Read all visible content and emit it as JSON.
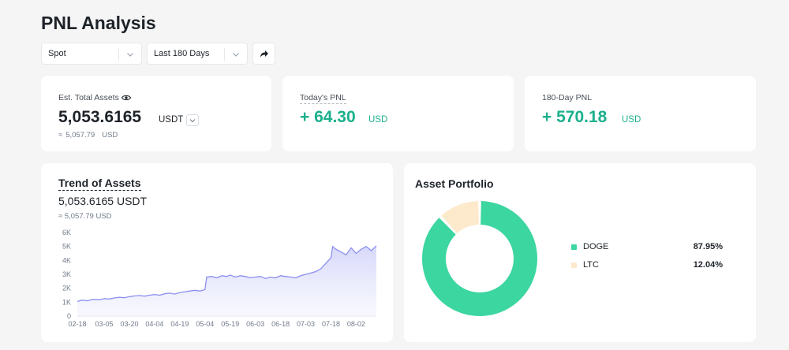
{
  "page_title": "PNL Analysis",
  "filters": {
    "account_type": "Spot",
    "time_range": "Last 180 Days"
  },
  "summary": {
    "total_assets": {
      "label": "Est. Total Assets",
      "value": "5,053.6165",
      "unit": "USDT",
      "approx_symbol": "≈",
      "approx_value": "5,057.79",
      "approx_unit": "USD"
    },
    "today_pnl": {
      "label": "Today's PNL",
      "value": "+ 64.30",
      "unit": "USD"
    },
    "pnl_180": {
      "label": "180-Day PNL",
      "value": "+ 570.18",
      "unit": "USD"
    }
  },
  "trend": {
    "title": "Trend of Assets",
    "value": "5,053.6165 USDT",
    "approx": "≈ 5,057.79 USD"
  },
  "portfolio": {
    "title": "Asset Portfolio",
    "items": [
      {
        "name": "DOGE",
        "percent": "87.95%",
        "value": 87.95,
        "color": "#3cd6a0"
      },
      {
        "name": "LTC",
        "percent": "12.04%",
        "value": 12.04,
        "color": "#fde9cc"
      }
    ]
  },
  "colors": {
    "accent_green": "#1bb08c",
    "chart_line": "#8c8ff0",
    "chart_fill": "#e4e6fb"
  },
  "chart_data": {
    "type": "area",
    "title": "Trend of Assets",
    "xlabel": "",
    "ylabel": "",
    "ylim": [
      0,
      6000
    ],
    "y_ticks": [
      "0",
      "1K",
      "2K",
      "3K",
      "4K",
      "5K",
      "6K"
    ],
    "y_tick_values": [
      0,
      1000,
      2000,
      3000,
      4000,
      5000,
      6000
    ],
    "x_ticks": [
      "02-18",
      "03-05",
      "03-20",
      "04-04",
      "04-19",
      "05-04",
      "05-19",
      "06-03",
      "06-18",
      "07-03",
      "07-18",
      "08-02"
    ],
    "grid": false,
    "series": [
      {
        "x": [
          "02-18",
          "02-21",
          "02-24",
          "02-27",
          "03-02",
          "03-05",
          "03-08",
          "03-11",
          "03-14",
          "03-17",
          "03-20",
          "03-23",
          "03-26",
          "03-29",
          "04-01",
          "04-04",
          "04-07",
          "04-10",
          "04-13",
          "04-16",
          "04-19",
          "04-22",
          "04-25",
          "04-28",
          "05-01",
          "05-04",
          "05-05",
          "05-08",
          "05-11",
          "05-14",
          "05-17",
          "05-19",
          "05-22",
          "05-25",
          "05-28",
          "05-31",
          "06-03",
          "06-06",
          "06-09",
          "06-12",
          "06-15",
          "06-18",
          "06-21",
          "06-24",
          "06-27",
          "06-30",
          "07-03",
          "07-06",
          "07-09",
          "07-12",
          "07-15",
          "07-18",
          "07-19",
          "07-21",
          "07-24",
          "07-27",
          "07-30",
          "08-02",
          "08-05",
          "08-08",
          "08-11",
          "08-14"
        ],
        "values": [
          1050,
          1150,
          1100,
          1200,
          1180,
          1250,
          1230,
          1300,
          1350,
          1320,
          1400,
          1450,
          1480,
          1430,
          1500,
          1550,
          1500,
          1600,
          1650,
          1580,
          1700,
          1750,
          1800,
          1850,
          1800,
          1900,
          2800,
          2850,
          2750,
          2900,
          2850,
          2950,
          2800,
          2900,
          2850,
          2750,
          2800,
          2850,
          2700,
          2800,
          2750,
          2900,
          2850,
          2800,
          2750,
          2900,
          3000,
          3100,
          3200,
          3400,
          3800,
          4200,
          5000,
          4800,
          4600,
          4400,
          4900,
          4500,
          4800,
          5000,
          4700,
          5050
        ]
      }
    ]
  }
}
